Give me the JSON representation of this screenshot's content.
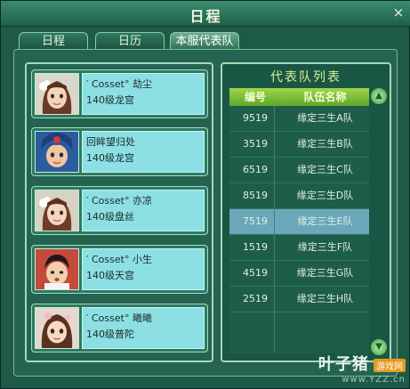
{
  "window": {
    "title": "日程",
    "close_glyph": "×"
  },
  "tabs": [
    {
      "label": "日程",
      "active": false
    },
    {
      "label": "日历",
      "active": false
    },
    {
      "label": "本服代表队",
      "active": true
    }
  ],
  "characters": [
    {
      "name": "′ Cosset° 劫尘",
      "rank": "140级龙宫"
    },
    {
      "name": "回眸望归处",
      "rank": "140级龙宫"
    },
    {
      "name": "′ Cosset° 亦凉",
      "rank": "140级盘丝"
    },
    {
      "name": "′ Cosset° 小生",
      "rank": "140级天宫"
    },
    {
      "name": "′ Cosset° 曦曦",
      "rank": "140级普陀"
    }
  ],
  "team_list": {
    "title": "代表队列表",
    "columns": [
      "编号",
      "队伍名称"
    ],
    "rows": [
      {
        "id": "9519",
        "name": "缘定三生A队",
        "selected": false
      },
      {
        "id": "3519",
        "name": "缘定三生B队",
        "selected": false
      },
      {
        "id": "6519",
        "name": "缘定三生C队",
        "selected": false
      },
      {
        "id": "8519",
        "name": "缘定三生D队",
        "selected": false
      },
      {
        "id": "7519",
        "name": "缘定三生E队",
        "selected": true
      },
      {
        "id": "1519",
        "name": "缘定三生F队",
        "selected": false
      },
      {
        "id": "4519",
        "name": "缘定三生G队",
        "selected": false
      },
      {
        "id": "2519",
        "name": "缘定三生H队",
        "selected": false
      }
    ]
  },
  "watermark": {
    "brand": "叶子猪",
    "badge": "游戏网",
    "url": "www.YZZ.cn"
  }
}
